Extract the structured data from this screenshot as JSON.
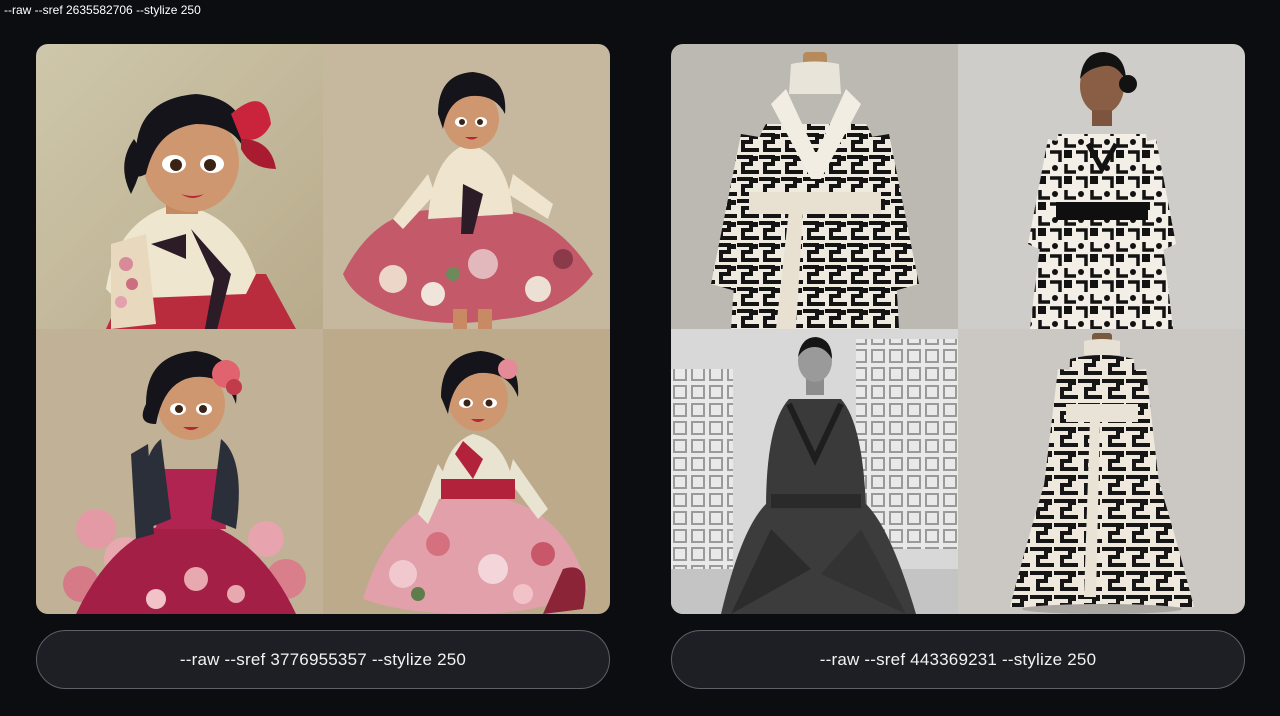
{
  "page_caption": "--raw --sref 2635582706 --stylize 250",
  "cards": [
    {
      "prompt": "--raw --sref 3776955357 --stylize 250",
      "style": "illustrated cartoon hanbok girls",
      "tiles": [
        {
          "bg": "#cfc6a8",
          "accent": "#b2223a",
          "figure": "#f1e6cf",
          "subject": "cartoon girl with red hair bow in cream hanbok"
        },
        {
          "bg": "#c9bda6",
          "accent": "#c24a5c",
          "figure": "#efe4cd",
          "subject": "cartoon girl twirling pink floral skirt"
        },
        {
          "bg": "#c7b79c",
          "accent": "#a81d45",
          "figure": "#2b2f3a",
          "subject": "cartoon girl in dark jacket with magenta dress and pink flowers"
        },
        {
          "bg": "#c3b093",
          "accent": "#d77b88",
          "figure": "#e9e3d2",
          "subject": "cartoon girl in pink floral hanbok skirt"
        }
      ]
    },
    {
      "prompt": "--raw --sref 443369231 --stylize 250",
      "style": "black and white geometric hanbok fashion",
      "tiles": [
        {
          "bg": "#bdbab5",
          "accent": "#1a1a1a",
          "figure": "#efeae0",
          "subject": "mannequin in geometric patterned hanbok with cream sash"
        },
        {
          "bg": "#cfcdca",
          "accent": "#121212",
          "figure": "#f3efe6",
          "subject": "model in geometric black and white dress with black belt"
        },
        {
          "bg": "#d5d5d5",
          "accent": "#2e2e2e",
          "figure": "#3a3a3a",
          "subject": "woman in dark gray hanbok before lattice walls"
        },
        {
          "bg": "#cbc8c3",
          "accent": "#161616",
          "figure": "#efe9dd",
          "subject": "mannequin in long geometric gown with cream sash"
        }
      ]
    }
  ]
}
